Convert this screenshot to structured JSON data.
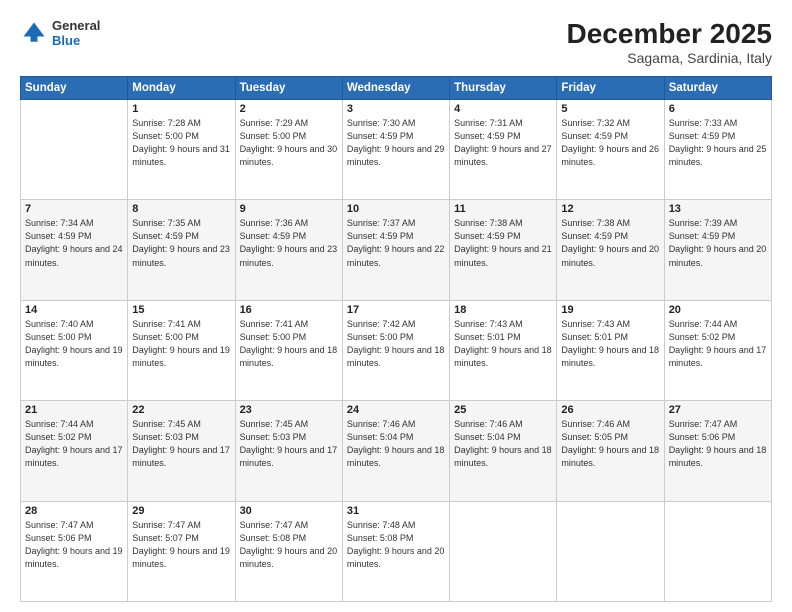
{
  "logo": {
    "general": "General",
    "blue": "Blue"
  },
  "title": "December 2025",
  "subtitle": "Sagama, Sardinia, Italy",
  "days_header": [
    "Sunday",
    "Monday",
    "Tuesday",
    "Wednesday",
    "Thursday",
    "Friday",
    "Saturday"
  ],
  "weeks": [
    [
      {
        "day": "",
        "sunrise": "",
        "sunset": "",
        "daylight": ""
      },
      {
        "day": "1",
        "sunrise": "Sunrise: 7:28 AM",
        "sunset": "Sunset: 5:00 PM",
        "daylight": "Daylight: 9 hours and 31 minutes."
      },
      {
        "day": "2",
        "sunrise": "Sunrise: 7:29 AM",
        "sunset": "Sunset: 5:00 PM",
        "daylight": "Daylight: 9 hours and 30 minutes."
      },
      {
        "day": "3",
        "sunrise": "Sunrise: 7:30 AM",
        "sunset": "Sunset: 4:59 PM",
        "daylight": "Daylight: 9 hours and 29 minutes."
      },
      {
        "day": "4",
        "sunrise": "Sunrise: 7:31 AM",
        "sunset": "Sunset: 4:59 PM",
        "daylight": "Daylight: 9 hours and 27 minutes."
      },
      {
        "day": "5",
        "sunrise": "Sunrise: 7:32 AM",
        "sunset": "Sunset: 4:59 PM",
        "daylight": "Daylight: 9 hours and 26 minutes."
      },
      {
        "day": "6",
        "sunrise": "Sunrise: 7:33 AM",
        "sunset": "Sunset: 4:59 PM",
        "daylight": "Daylight: 9 hours and 25 minutes."
      }
    ],
    [
      {
        "day": "7",
        "sunrise": "Sunrise: 7:34 AM",
        "sunset": "Sunset: 4:59 PM",
        "daylight": "Daylight: 9 hours and 24 minutes."
      },
      {
        "day": "8",
        "sunrise": "Sunrise: 7:35 AM",
        "sunset": "Sunset: 4:59 PM",
        "daylight": "Daylight: 9 hours and 23 minutes."
      },
      {
        "day": "9",
        "sunrise": "Sunrise: 7:36 AM",
        "sunset": "Sunset: 4:59 PM",
        "daylight": "Daylight: 9 hours and 23 minutes."
      },
      {
        "day": "10",
        "sunrise": "Sunrise: 7:37 AM",
        "sunset": "Sunset: 4:59 PM",
        "daylight": "Daylight: 9 hours and 22 minutes."
      },
      {
        "day": "11",
        "sunrise": "Sunrise: 7:38 AM",
        "sunset": "Sunset: 4:59 PM",
        "daylight": "Daylight: 9 hours and 21 minutes."
      },
      {
        "day": "12",
        "sunrise": "Sunrise: 7:38 AM",
        "sunset": "Sunset: 4:59 PM",
        "daylight": "Daylight: 9 hours and 20 minutes."
      },
      {
        "day": "13",
        "sunrise": "Sunrise: 7:39 AM",
        "sunset": "Sunset: 4:59 PM",
        "daylight": "Daylight: 9 hours and 20 minutes."
      }
    ],
    [
      {
        "day": "14",
        "sunrise": "Sunrise: 7:40 AM",
        "sunset": "Sunset: 5:00 PM",
        "daylight": "Daylight: 9 hours and 19 minutes."
      },
      {
        "day": "15",
        "sunrise": "Sunrise: 7:41 AM",
        "sunset": "Sunset: 5:00 PM",
        "daylight": "Daylight: 9 hours and 19 minutes."
      },
      {
        "day": "16",
        "sunrise": "Sunrise: 7:41 AM",
        "sunset": "Sunset: 5:00 PM",
        "daylight": "Daylight: 9 hours and 18 minutes."
      },
      {
        "day": "17",
        "sunrise": "Sunrise: 7:42 AM",
        "sunset": "Sunset: 5:00 PM",
        "daylight": "Daylight: 9 hours and 18 minutes."
      },
      {
        "day": "18",
        "sunrise": "Sunrise: 7:43 AM",
        "sunset": "Sunset: 5:01 PM",
        "daylight": "Daylight: 9 hours and 18 minutes."
      },
      {
        "day": "19",
        "sunrise": "Sunrise: 7:43 AM",
        "sunset": "Sunset: 5:01 PM",
        "daylight": "Daylight: 9 hours and 18 minutes."
      },
      {
        "day": "20",
        "sunrise": "Sunrise: 7:44 AM",
        "sunset": "Sunset: 5:02 PM",
        "daylight": "Daylight: 9 hours and 17 minutes."
      }
    ],
    [
      {
        "day": "21",
        "sunrise": "Sunrise: 7:44 AM",
        "sunset": "Sunset: 5:02 PM",
        "daylight": "Daylight: 9 hours and 17 minutes."
      },
      {
        "day": "22",
        "sunrise": "Sunrise: 7:45 AM",
        "sunset": "Sunset: 5:03 PM",
        "daylight": "Daylight: 9 hours and 17 minutes."
      },
      {
        "day": "23",
        "sunrise": "Sunrise: 7:45 AM",
        "sunset": "Sunset: 5:03 PM",
        "daylight": "Daylight: 9 hours and 17 minutes."
      },
      {
        "day": "24",
        "sunrise": "Sunrise: 7:46 AM",
        "sunset": "Sunset: 5:04 PM",
        "daylight": "Daylight: 9 hours and 18 minutes."
      },
      {
        "day": "25",
        "sunrise": "Sunrise: 7:46 AM",
        "sunset": "Sunset: 5:04 PM",
        "daylight": "Daylight: 9 hours and 18 minutes."
      },
      {
        "day": "26",
        "sunrise": "Sunrise: 7:46 AM",
        "sunset": "Sunset: 5:05 PM",
        "daylight": "Daylight: 9 hours and 18 minutes."
      },
      {
        "day": "27",
        "sunrise": "Sunrise: 7:47 AM",
        "sunset": "Sunset: 5:06 PM",
        "daylight": "Daylight: 9 hours and 18 minutes."
      }
    ],
    [
      {
        "day": "28",
        "sunrise": "Sunrise: 7:47 AM",
        "sunset": "Sunset: 5:06 PM",
        "daylight": "Daylight: 9 hours and 19 minutes."
      },
      {
        "day": "29",
        "sunrise": "Sunrise: 7:47 AM",
        "sunset": "Sunset: 5:07 PM",
        "daylight": "Daylight: 9 hours and 19 minutes."
      },
      {
        "day": "30",
        "sunrise": "Sunrise: 7:47 AM",
        "sunset": "Sunset: 5:08 PM",
        "daylight": "Daylight: 9 hours and 20 minutes."
      },
      {
        "day": "31",
        "sunrise": "Sunrise: 7:48 AM",
        "sunset": "Sunset: 5:08 PM",
        "daylight": "Daylight: 9 hours and 20 minutes."
      },
      {
        "day": "",
        "sunrise": "",
        "sunset": "",
        "daylight": ""
      },
      {
        "day": "",
        "sunrise": "",
        "sunset": "",
        "daylight": ""
      },
      {
        "day": "",
        "sunrise": "",
        "sunset": "",
        "daylight": ""
      }
    ]
  ]
}
